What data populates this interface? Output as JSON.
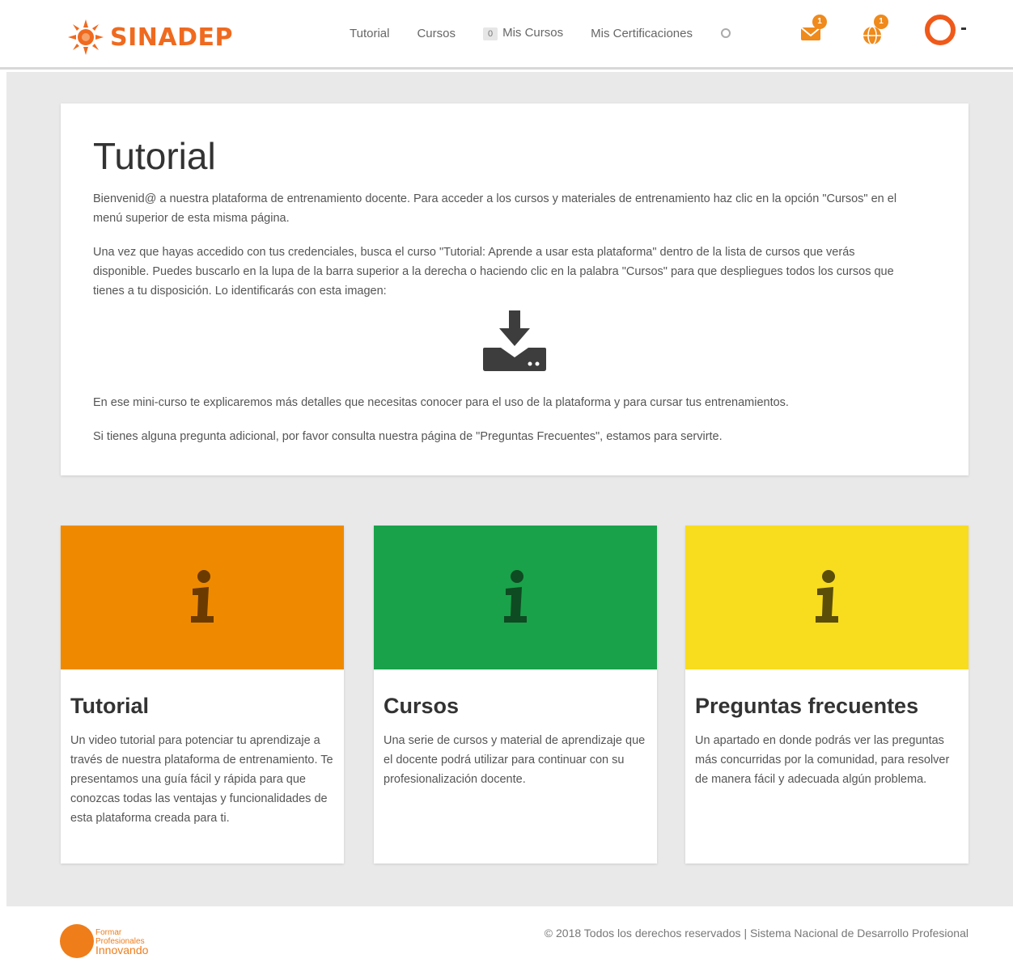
{
  "brand": {
    "name": "SINADEP",
    "accent": "#ef6a1f"
  },
  "nav": {
    "tutorial": "Tutorial",
    "cursos": "Cursos",
    "mis_cursos_badge": "0",
    "mis_cursos": "Mis Cursos",
    "mis_certificaciones": "Mis Certificaciones",
    "messages_count": "1",
    "notifications_count": "1"
  },
  "tutorial": {
    "title": "Tutorial",
    "p1": "Bienvenid@ a nuestra plataforma de entrenamiento docente. Para acceder a los cursos y materiales de entrenamiento haz clic en la opción \"Cursos\" en el menú superior de esta misma página.",
    "p2": "Una vez que hayas accedido con tus credenciales, busca el curso \"Tutorial: Aprende a usar esta plataforma\" dentro de la lista de cursos que verás disponible. Puedes buscarlo en la lupa de la barra superior a la derecha o haciendo clic en la palabra \"Cursos\" para que despliegues todos los cursos que tienes a tu disposición. Lo identificarás con esta imagen:",
    "p3": "En ese mini-curso te explicaremos más detalles que necesitas conocer para el uso de la plataforma y para cursar tus entrenamientos.",
    "p4": "Si tienes alguna pregunta adicional, por favor consulta nuestra página de \"Preguntas Frecuentes\", estamos para servirte."
  },
  "cards": [
    {
      "title": "Tutorial",
      "text": "Un video tutorial para potenciar tu aprendizaje a través de nuestra plataforma de entrenamiento. Te presentamos una guía fácil y rápida para que conozcas todas las ventajas y funcionalidades de esta plataforma creada para ti.",
      "color": "#ef8a00",
      "icon_color": "#6b3a00"
    },
    {
      "title": "Cursos",
      "text": "Una serie de cursos y material de aprendizaje que el docente podrá utilizar para continuar con su profesionalización docente.",
      "color": "#19a24a",
      "icon_color": "#0e4a22"
    },
    {
      "title": "Preguntas frecuentes",
      "text": "Un apartado en donde podrás ver las preguntas más concurridas por la comunidad, para resolver de manera fácil y adecuada algún problema.",
      "color": "#f8dc1e",
      "icon_color": "#5a4e08"
    }
  ],
  "footer": {
    "logo_line1": "Formar",
    "logo_line2": "Profesionales",
    "logo_line3": "Innovando",
    "copyright": "© 2018 Todos los derechos reservados | Sistema Nacional de Desarrollo Profesional"
  }
}
